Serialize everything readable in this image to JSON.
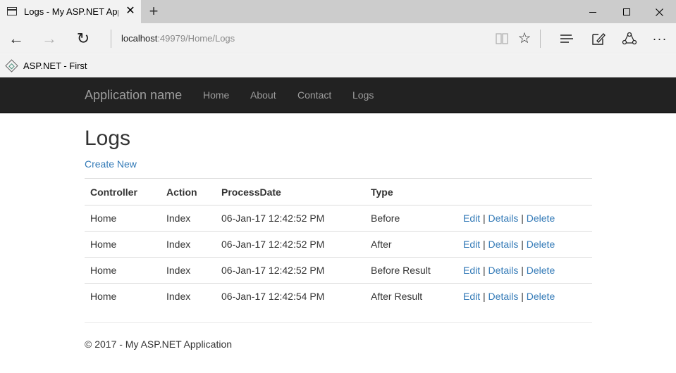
{
  "browser": {
    "tab_title": "Logs - My ASP.NET App",
    "tab_close": "✕",
    "new_tab": "+",
    "url_host": "localhost",
    "url_rest": ":49979/Home/Logs",
    "favorite_label": "ASP.NET - First"
  },
  "site": {
    "brand": "Application name",
    "nav": [
      "Home",
      "About",
      "Contact",
      "Logs"
    ]
  },
  "page": {
    "title": "Logs",
    "create_new": "Create New",
    "columns": [
      "Controller",
      "Action",
      "ProcessDate",
      "Type"
    ],
    "rows": [
      {
        "controller": "Home",
        "action": "Index",
        "date": "06-Jan-17 12:42:52 PM",
        "type": "Before"
      },
      {
        "controller": "Home",
        "action": "Index",
        "date": "06-Jan-17 12:42:52 PM",
        "type": "After"
      },
      {
        "controller": "Home",
        "action": "Index",
        "date": "06-Jan-17 12:42:52 PM",
        "type": "Before Result"
      },
      {
        "controller": "Home",
        "action": "Index",
        "date": "06-Jan-17 12:42:54 PM",
        "type": "After Result"
      }
    ],
    "row_actions": {
      "edit": "Edit",
      "details": "Details",
      "delete": "Delete",
      "separator": "|"
    },
    "footer": "© 2017 - My ASP.NET Application"
  },
  "icons": {
    "back": "←",
    "forward": "→",
    "refresh": "↻",
    "favorite": "☆",
    "more": "···"
  },
  "colors": {
    "link": "#337ab7",
    "navbar": "#222222",
    "navbar_text": "#9d9d9d"
  }
}
